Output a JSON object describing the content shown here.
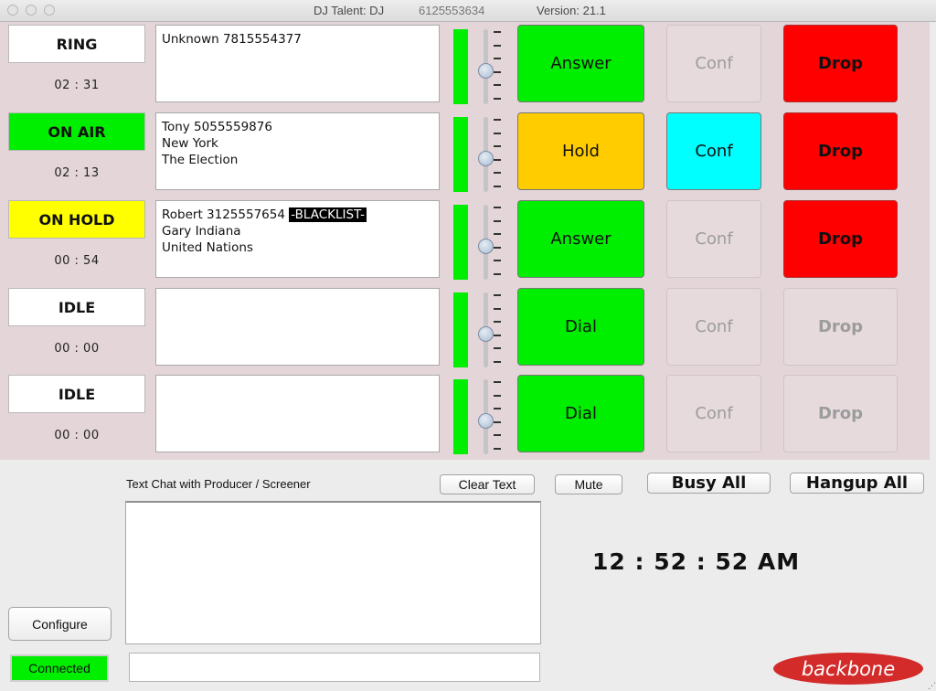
{
  "window": {
    "app_title": "DJ Talent: DJ",
    "phone_number": "6125553634",
    "version": "Version: 21.1"
  },
  "lines": [
    {
      "status": "RING",
      "status_color": "#ffffff",
      "timer": "02 : 31",
      "caller_lines": [
        "Unknown 7815554377"
      ],
      "blacklist_tag": "",
      "meter_level": 1.0,
      "volume": 0.5,
      "action_button": {
        "label": "Answer",
        "color": "#00ee00",
        "enabled": true
      },
      "conf_button": {
        "label": "Conf",
        "enabled": false
      },
      "drop_button": {
        "label": "Drop",
        "enabled": true
      }
    },
    {
      "status": "ON AIR",
      "status_color": "#00ee00",
      "timer": "02 : 13",
      "caller_lines": [
        "Tony 5055559876",
        "New York",
        "The Election"
      ],
      "blacklist_tag": "",
      "meter_level": 1.0,
      "volume": 0.5,
      "action_button": {
        "label": "Hold",
        "color": "#ffcc00",
        "enabled": true
      },
      "conf_button": {
        "label": "Conf",
        "enabled": true
      },
      "drop_button": {
        "label": "Drop",
        "enabled": true
      }
    },
    {
      "status": "ON HOLD",
      "status_color": "#ffff00",
      "timer": "00 : 54",
      "caller_lines": [
        "Robert 3125557654",
        "Gary Indiana",
        "United Nations"
      ],
      "blacklist_tag": "-BLACKLIST-",
      "meter_level": 1.0,
      "volume": 0.5,
      "action_button": {
        "label": "Answer",
        "color": "#00ee00",
        "enabled": true
      },
      "conf_button": {
        "label": "Conf",
        "enabled": false
      },
      "drop_button": {
        "label": "Drop",
        "enabled": true
      }
    },
    {
      "status": "IDLE",
      "status_color": "#ffffff",
      "timer": "00 : 00",
      "caller_lines": [],
      "blacklist_tag": "",
      "meter_level": 1.0,
      "volume": 0.5,
      "action_button": {
        "label": "Dial",
        "color": "#00ee00",
        "enabled": true
      },
      "conf_button": {
        "label": "Conf",
        "enabled": false
      },
      "drop_button": {
        "label": "Drop",
        "enabled": false
      }
    },
    {
      "status": "IDLE",
      "status_color": "#ffffff",
      "timer": "00 : 00",
      "caller_lines": [],
      "blacklist_tag": "",
      "meter_level": 1.0,
      "volume": 0.5,
      "action_button": {
        "label": "Dial",
        "color": "#00ee00",
        "enabled": true
      },
      "conf_button": {
        "label": "Conf",
        "enabled": false
      },
      "drop_button": {
        "label": "Drop",
        "enabled": false
      }
    }
  ],
  "chat": {
    "label": "Text Chat with Producer / Screener",
    "clear_label": "Clear Text",
    "mute_label": "Mute",
    "history": "",
    "input_value": ""
  },
  "controls": {
    "busy_all_label": "Busy All",
    "hangup_all_label": "Hangup All",
    "configure_label": "Configure"
  },
  "status": {
    "connection": "Connected",
    "connection_color": "#00ee00",
    "clock": "12 : 52 : 52 AM"
  },
  "brand": {
    "logo_text": "backbone",
    "logo_color": "#d32a2a"
  },
  "colors": {
    "conf_active": "#00ffff",
    "drop_active": "#ff0000",
    "disabled_bg": "#e6dadd",
    "panel_bg": "#e3d5d8"
  }
}
